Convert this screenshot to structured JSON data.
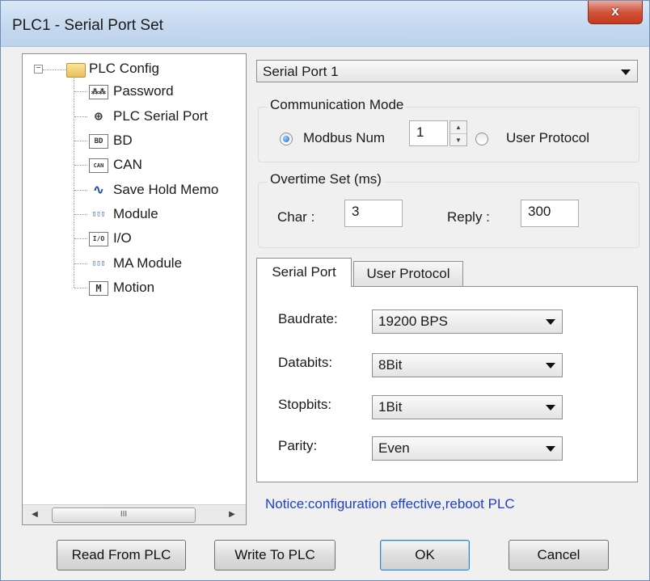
{
  "window": {
    "title": "PLC1 - Serial Port  Set",
    "close_label": "x"
  },
  "tree": {
    "root_label": "PLC Config",
    "expander": "−",
    "items": [
      {
        "label": "Password",
        "icon": "password-icon",
        "icon_text": "⁂⁂"
      },
      {
        "label": "PLC Serial Port",
        "icon": "serial-port-icon",
        "icon_text": "⊕"
      },
      {
        "label": "BD",
        "icon": "bd-icon",
        "icon_text": "BD"
      },
      {
        "label": "CAN",
        "icon": "can-icon",
        "icon_text": "CAN"
      },
      {
        "label": "Save Hold Memo",
        "icon": "waveform-icon",
        "icon_text": "∿"
      },
      {
        "label": "Module",
        "icon": "module-icon",
        "icon_text": "▯▯▯"
      },
      {
        "label": "I/O",
        "icon": "io-icon",
        "icon_text": "I/O"
      },
      {
        "label": "MA Module",
        "icon": "ma-module-icon",
        "icon_text": "▯▯▯"
      },
      {
        "label": "Motion",
        "icon": "motion-icon",
        "icon_text": "M"
      }
    ],
    "scroll_left": "◀",
    "scroll_right": "▶",
    "scroll_thumb": "III"
  },
  "port_select": {
    "value": "Serial Port 1"
  },
  "comm_mode": {
    "group_label": "Communication Mode",
    "modbus_label": "Modbus Num",
    "modbus_value": "1",
    "user_protocol_label": "User Protocol",
    "selected": "modbus"
  },
  "overtime": {
    "group_label": "Overtime Set (ms)",
    "char_label": "Char :",
    "char_value": "3",
    "reply_label": "Reply :",
    "reply_value": "300"
  },
  "tabs": [
    {
      "label": "Serial Port",
      "active": true
    },
    {
      "label": "User Protocol",
      "active": false
    }
  ],
  "serial_settings": {
    "baudrate_label": "Baudrate:",
    "baudrate_value": "19200 BPS",
    "databits_label": "Databits:",
    "databits_value": "8Bit",
    "stopbits_label": "Stopbits:",
    "stopbits_value": "1Bit",
    "parity_label": "Parity:",
    "parity_value": "Even"
  },
  "notice": "Notice:configuration effective,reboot PLC",
  "buttons": {
    "read": "Read From PLC",
    "write": "Write To PLC",
    "ok": "OK",
    "cancel": "Cancel"
  },
  "colors": {
    "notice": "#1e3fc8",
    "close_button": "#c3391d",
    "title_bar": "#c5d9ef"
  }
}
